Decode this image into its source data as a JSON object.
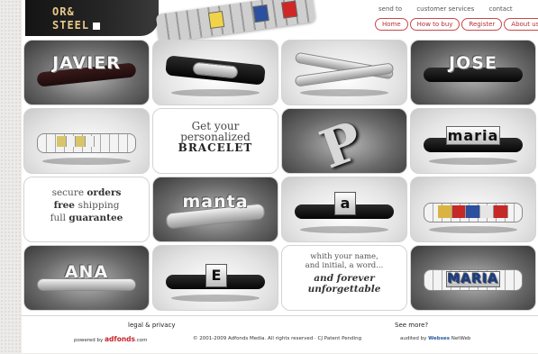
{
  "logo": {
    "line1": "OR&",
    "line2": "STEEL"
  },
  "topnav": [
    "send to",
    "customer services",
    "contact"
  ],
  "mainnav": [
    "Home",
    "How to buy",
    "Register",
    "About us"
  ],
  "tiles": {
    "javier": "JAVIER",
    "jose": "JOSE",
    "maria": "maria",
    "manta": "manta",
    "a_charm": "a",
    "ana": "ANA",
    "e_charm": "E",
    "maria_caps": "MARIA",
    "p_charm": "P",
    "promo_get": [
      "Get your",
      "personalized",
      "BRACELET"
    ],
    "promo_secure": [
      {
        "text": "secure ",
        "bold": "orders"
      },
      {
        "text": "free ",
        "bold": "shipping"
      },
      {
        "text": "full ",
        "bold": "guarantee"
      }
    ],
    "promo_with": {
      "line1": "whith your name,",
      "line2": "and initial, a word...",
      "line3": "and forever",
      "line4": "unforgettable"
    }
  },
  "footer": {
    "legal": "legal & privacy",
    "see_more": "See more?",
    "powered_by": "powered by",
    "brand": "adfonds",
    "brand_suffix": ".com",
    "copyright": "© 2001-2009 Adfonds Media. All rights reserved · CJ Patent Pending",
    "audited_by": "audited by",
    "auditor": "Webses",
    "auditor_suffix": " NetWeb"
  },
  "colors": {
    "accent": "#c8494b",
    "logo_text": "#e6c88a"
  }
}
